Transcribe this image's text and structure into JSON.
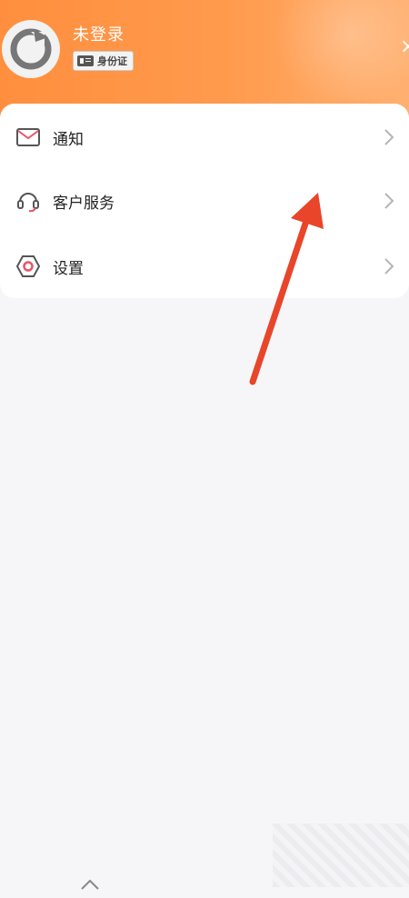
{
  "user": {
    "name": "未登录",
    "id_badge_label": "身份证"
  },
  "header": {
    "close_glyph": "×"
  },
  "menu": {
    "items": [
      {
        "label": "通知",
        "icon": "mail-icon"
      },
      {
        "label": "客户服务",
        "icon": "headset-icon"
      },
      {
        "label": "设置",
        "icon": "settings-icon"
      }
    ]
  },
  "colors": {
    "header_orange": "#ff8f3e",
    "icon_accent": "#e8546a",
    "annotation_arrow": "#e8452a"
  }
}
